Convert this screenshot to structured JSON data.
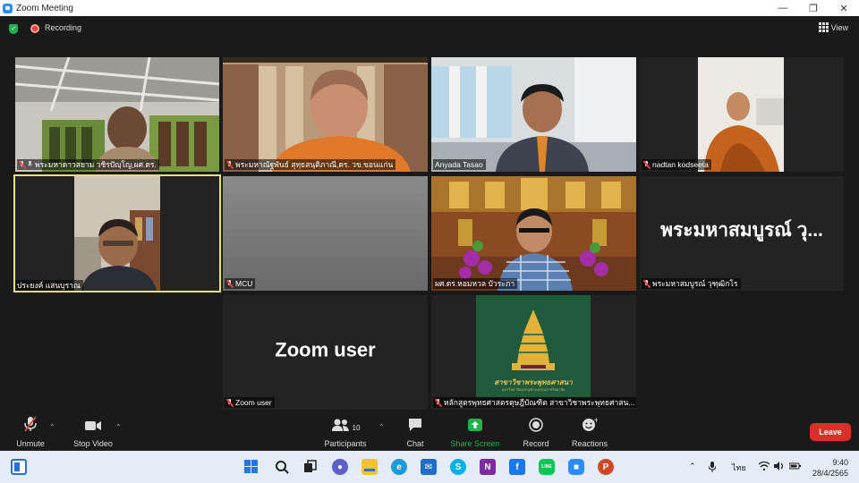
{
  "window": {
    "title": "Zoom Meeting"
  },
  "topbar": {
    "recording_label": "Recording",
    "view_label": "View"
  },
  "participants": [
    {
      "name": "พระมหาดาวสยาม วชิรปัญฺโญ,ผศ.ดร.",
      "muted": true,
      "pinned": true
    },
    {
      "name": "พระมหาณัฐพันธ์ สุทฺธสนฺติภาณี,ดร. วข.ขอนแก่น",
      "muted": true
    },
    {
      "name": "Anyada Tasao",
      "muted": false
    },
    {
      "name": "nadtan kodseeta",
      "muted": true
    },
    {
      "name": "ประยงค์ แสนบุราณ",
      "muted": false,
      "active": true
    },
    {
      "name": "MCU",
      "muted": true
    },
    {
      "name": "ผศ.ดร.หอมหวล บัวระภา",
      "muted": false
    },
    {
      "name": "พระมหาสมบูรณ์ วุฑฺฒิกโร",
      "muted": true,
      "display": "พระมหาสมบูรณ์ วุ..."
    },
    {
      "name": "Zoom user",
      "muted": true,
      "display": "Zoom user"
    },
    {
      "name": "หลักสูตรพุทธศาสตรดุษฎีบัณฑิต สาขาวิชาพระพุทธศาสน...",
      "muted": true,
      "logo_text": "สาขาวิชาพระพุทธศาสนา",
      "logo_sub": "มหาวิทยาลัยมหาจุฬาลงกรณราชวิทยาลัย"
    }
  ],
  "toolbar": {
    "unmute": "Unmute",
    "stop_video": "Stop Video",
    "participants": "Participants",
    "participants_count": "10",
    "chat": "Chat",
    "share_screen": "Share Screen",
    "record": "Record",
    "reactions": "Reactions",
    "leave": "Leave"
  },
  "taskbar": {
    "lang": "ไทย",
    "time": "9:40",
    "date": "28/4/2565"
  },
  "colors": {
    "accent": "#2d8cff",
    "leave": "#d9302a",
    "active_speaker": "#e8e46b",
    "share_green": "#23b14d",
    "logo_bg": "#1f5a3a"
  }
}
